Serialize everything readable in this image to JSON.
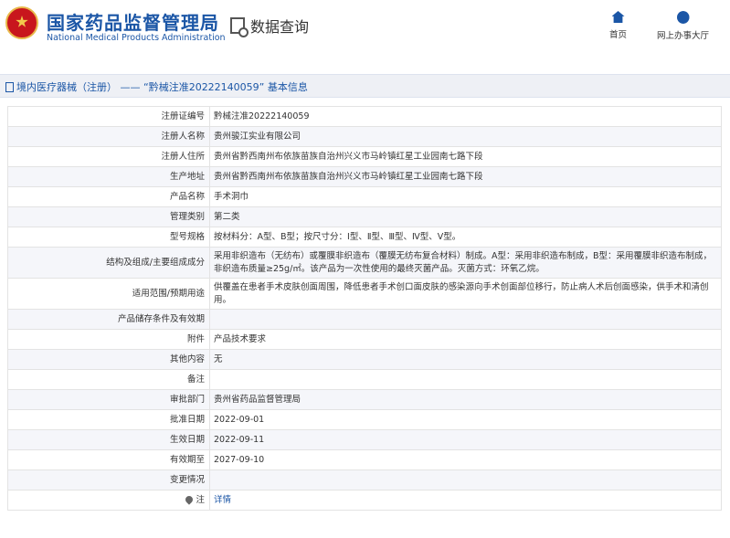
{
  "header": {
    "brand_cn": "国家药品监督管理局",
    "brand_en": "National Medical Products Administration",
    "query_title": "数据查询",
    "nav": [
      {
        "label": "首页",
        "icon": "home-icon"
      },
      {
        "label": "网上办事大厅",
        "icon": "user-icon"
      }
    ]
  },
  "breadcrumb": "境内医疗器械（注册） —— “黔械注准20222140059” 基本信息",
  "rows": [
    {
      "label": "注册证编号",
      "value": "黔械注准20222140059"
    },
    {
      "label": "注册人名称",
      "value": "贵州骏江实业有限公司"
    },
    {
      "label": "注册人住所",
      "value": "贵州省黔西南州布依族苗族自治州兴义市马岭镇红星工业园南七路下段"
    },
    {
      "label": "生产地址",
      "value": "贵州省黔西南州布依族苗族自治州兴义市马岭镇红星工业园南七路下段"
    },
    {
      "label": "产品名称",
      "value": "手术洞巾"
    },
    {
      "label": "管理类别",
      "value": "第二类"
    },
    {
      "label": "型号规格",
      "value": "按材料分：A型、B型；按尺寸分：Ⅰ型、Ⅱ型、Ⅲ型、Ⅳ型、Ⅴ型。"
    },
    {
      "label": "结构及组成/主要组成成分",
      "value": "采用非织造布（无纺布）或覆膜非织造布（覆膜无纺布复合材料）制成。A型：采用非织造布制成，B型：采用覆膜非织造布制成，非织造布质量≥25g/㎡。该产品为一次性使用的最终灭菌产品。灭菌方式：环氧乙烷。"
    },
    {
      "label": "适用范围/预期用途",
      "value": "供覆盖在患者手术皮肤创面周围，降低患者手术创口面皮肤的感染源向手术创面部位移行，防止病人术后创面感染，供手术和清创用。"
    },
    {
      "label": "产品储存条件及有效期",
      "value": ""
    },
    {
      "label": "附件",
      "value": "产品技术要求"
    },
    {
      "label": "其他内容",
      "value": "无"
    },
    {
      "label": "备注",
      "value": ""
    },
    {
      "label": "审批部门",
      "value": "贵州省药品监督管理局"
    },
    {
      "label": "批准日期",
      "value": "2022-09-01"
    },
    {
      "label": "生效日期",
      "value": "2022-09-11"
    },
    {
      "label": "有效期至",
      "value": "2027-09-10"
    },
    {
      "label": "变更情况",
      "value": ""
    },
    {
      "label": "注",
      "value": "详情"
    }
  ]
}
